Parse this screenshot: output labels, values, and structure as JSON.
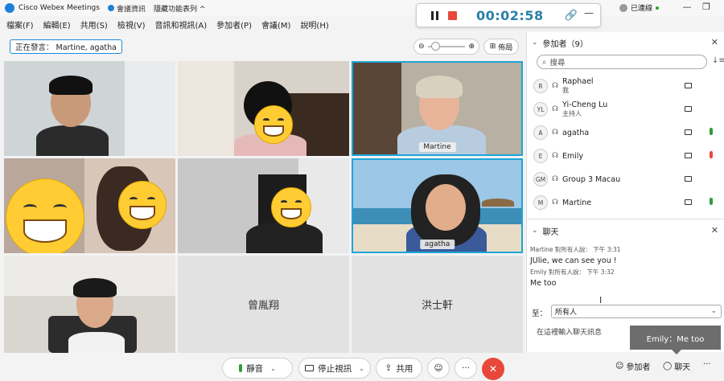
{
  "titlebar": {
    "app_name": "Cisco Webex Meetings",
    "meeting_info": "會議資訊",
    "hide_menu": "隱藏功能表列 ^",
    "connection": "已連線",
    "min_icon": "—",
    "restore_icon": "❐"
  },
  "menu": [
    "檔案(F)",
    "編輯(E)",
    "共用(S)",
    "檢視(V)",
    "音訊和視訊(A)",
    "參加者(P)",
    "會議(M)",
    "說明(H)"
  ],
  "recorder": {
    "time": "00:02:58",
    "min_icon": "—",
    "link_icon": "🔗"
  },
  "speaking": "正在發言： Martine, agatha",
  "zoom": {
    "minus": "⊖",
    "plus": "⊕"
  },
  "layout_button": "佈局",
  "tiles": {
    "martine": "Martine",
    "agatha": "agatha",
    "name1": "曾胤翔",
    "name2": "洪士軒"
  },
  "participants": {
    "header": "參加者（9）",
    "search_placeholder": "搜尋",
    "items": [
      {
        "initials": "R",
        "name": "Raphael",
        "sub": "我",
        "mic_color": ""
      },
      {
        "initials": "YL",
        "name": "Yi-Cheng Lu",
        "sub": "主持人",
        "mic_color": ""
      },
      {
        "initials": "A",
        "name": "agatha",
        "sub": "",
        "mic_color": "#2e9d3a"
      },
      {
        "initials": "E",
        "name": "Emily",
        "sub": "",
        "mic_color": "#e8483a"
      },
      {
        "initials": "GM",
        "name": "Group 3 Macau",
        "sub": "",
        "mic_color": ""
      },
      {
        "initials": "M",
        "name": "Martine",
        "sub": "",
        "mic_color": "#2e9d3a"
      }
    ]
  },
  "chat": {
    "header": "聊天",
    "messages": [
      {
        "meta": "Martine 對所有人說：  下午 3:31",
        "text": "JUlie, we can see you !"
      },
      {
        "meta": "Emily 對所有人說：  下午 3:32",
        "text": "Me too"
      }
    ],
    "to_label": "至：",
    "to_value": "所有人",
    "input_placeholder": "在這裡輸入聊天訊息"
  },
  "tooltip": "Emily：Me too",
  "toolbar": {
    "mute": "靜音",
    "stop_video": "停止視訊",
    "share": "共用",
    "participants": "參加者",
    "chat": "聊天",
    "more": "···"
  },
  "colors": {
    "accent": "#1ea5d8",
    "end": "#e8483a",
    "mic_on": "#2e9d3a"
  }
}
